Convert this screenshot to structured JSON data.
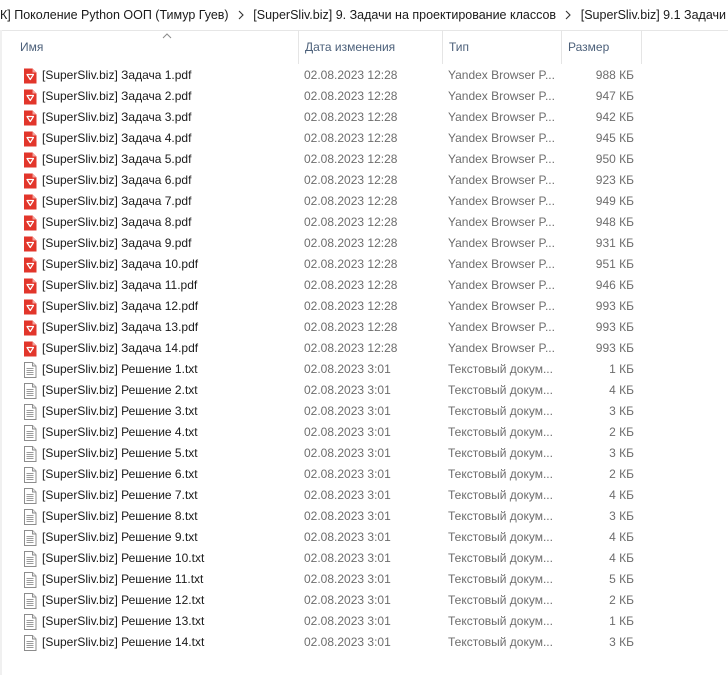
{
  "breadcrumb": {
    "items": [
      "К] Поколение Python ООП (Тимур Гуев)",
      "[SuperSliv.biz] 9. Задачи на проектирование классов",
      "[SuperSliv.biz] 9.1 Задачи"
    ]
  },
  "columns": {
    "name": "Имя",
    "date": "Дата изменения",
    "type": "Тип",
    "size": "Размер"
  },
  "colors": {
    "pdf_icon": "#e2362b",
    "header_text": "#4c607a",
    "secondary_text": "#6d6d6d"
  },
  "files": [
    {
      "name": "[SuperSliv.biz] Задача 1.pdf",
      "date": "02.08.2023 12:28",
      "type": "Yandex Browser P...",
      "size": "988 КБ",
      "icon": "pdf-icon"
    },
    {
      "name": "[SuperSliv.biz] Задача 2.pdf",
      "date": "02.08.2023 12:28",
      "type": "Yandex Browser P...",
      "size": "947 КБ",
      "icon": "pdf-icon"
    },
    {
      "name": "[SuperSliv.biz] Задача 3.pdf",
      "date": "02.08.2023 12:28",
      "type": "Yandex Browser P...",
      "size": "942 КБ",
      "icon": "pdf-icon"
    },
    {
      "name": "[SuperSliv.biz] Задача 4.pdf",
      "date": "02.08.2023 12:28",
      "type": "Yandex Browser P...",
      "size": "945 КБ",
      "icon": "pdf-icon"
    },
    {
      "name": "[SuperSliv.biz] Задача 5.pdf",
      "date": "02.08.2023 12:28",
      "type": "Yandex Browser P...",
      "size": "950 КБ",
      "icon": "pdf-icon"
    },
    {
      "name": "[SuperSliv.biz] Задача 6.pdf",
      "date": "02.08.2023 12:28",
      "type": "Yandex Browser P...",
      "size": "923 КБ",
      "icon": "pdf-icon"
    },
    {
      "name": "[SuperSliv.biz] Задача 7.pdf",
      "date": "02.08.2023 12:28",
      "type": "Yandex Browser P...",
      "size": "949 КБ",
      "icon": "pdf-icon"
    },
    {
      "name": "[SuperSliv.biz] Задача 8.pdf",
      "date": "02.08.2023 12:28",
      "type": "Yandex Browser P...",
      "size": "948 КБ",
      "icon": "pdf-icon"
    },
    {
      "name": "[SuperSliv.biz] Задача 9.pdf",
      "date": "02.08.2023 12:28",
      "type": "Yandex Browser P...",
      "size": "931 КБ",
      "icon": "pdf-icon"
    },
    {
      "name": "[SuperSliv.biz] Задача 10.pdf",
      "date": "02.08.2023 12:28",
      "type": "Yandex Browser P...",
      "size": "951 КБ",
      "icon": "pdf-icon"
    },
    {
      "name": "[SuperSliv.biz] Задача 11.pdf",
      "date": "02.08.2023 12:28",
      "type": "Yandex Browser P...",
      "size": "946 КБ",
      "icon": "pdf-icon"
    },
    {
      "name": "[SuperSliv.biz] Задача 12.pdf",
      "date": "02.08.2023 12:28",
      "type": "Yandex Browser P...",
      "size": "993 КБ",
      "icon": "pdf-icon"
    },
    {
      "name": "[SuperSliv.biz] Задача 13.pdf",
      "date": "02.08.2023 12:28",
      "type": "Yandex Browser P...",
      "size": "993 КБ",
      "icon": "pdf-icon"
    },
    {
      "name": "[SuperSliv.biz] Задача 14.pdf",
      "date": "02.08.2023 12:28",
      "type": "Yandex Browser P...",
      "size": "993 КБ",
      "icon": "pdf-icon"
    },
    {
      "name": "[SuperSliv.biz] Решение 1.txt",
      "date": "02.08.2023 3:01",
      "type": "Текстовый докум...",
      "size": "1 КБ",
      "icon": "txt-icon"
    },
    {
      "name": "[SuperSliv.biz] Решение 2.txt",
      "date": "02.08.2023 3:01",
      "type": "Текстовый докум...",
      "size": "4 КБ",
      "icon": "txt-icon"
    },
    {
      "name": "[SuperSliv.biz] Решение 3.txt",
      "date": "02.08.2023 3:01",
      "type": "Текстовый докум...",
      "size": "3 КБ",
      "icon": "txt-icon"
    },
    {
      "name": "[SuperSliv.biz] Решение 4.txt",
      "date": "02.08.2023 3:01",
      "type": "Текстовый докум...",
      "size": "2 КБ",
      "icon": "txt-icon"
    },
    {
      "name": "[SuperSliv.biz] Решение 5.txt",
      "date": "02.08.2023 3:01",
      "type": "Текстовый докум...",
      "size": "3 КБ",
      "icon": "txt-icon"
    },
    {
      "name": "[SuperSliv.biz] Решение 6.txt",
      "date": "02.08.2023 3:01",
      "type": "Текстовый докум...",
      "size": "2 КБ",
      "icon": "txt-icon"
    },
    {
      "name": "[SuperSliv.biz] Решение 7.txt",
      "date": "02.08.2023 3:01",
      "type": "Текстовый докум...",
      "size": "4 КБ",
      "icon": "txt-icon"
    },
    {
      "name": "[SuperSliv.biz] Решение 8.txt",
      "date": "02.08.2023 3:01",
      "type": "Текстовый докум...",
      "size": "3 КБ",
      "icon": "txt-icon"
    },
    {
      "name": "[SuperSliv.biz] Решение 9.txt",
      "date": "02.08.2023 3:01",
      "type": "Текстовый докум...",
      "size": "4 КБ",
      "icon": "txt-icon"
    },
    {
      "name": "[SuperSliv.biz] Решение 10.txt",
      "date": "02.08.2023 3:01",
      "type": "Текстовый докум...",
      "size": "4 КБ",
      "icon": "txt-icon"
    },
    {
      "name": "[SuperSliv.biz] Решение 11.txt",
      "date": "02.08.2023 3:01",
      "type": "Текстовый докум...",
      "size": "5 КБ",
      "icon": "txt-icon"
    },
    {
      "name": "[SuperSliv.biz] Решение 12.txt",
      "date": "02.08.2023 3:01",
      "type": "Текстовый докум...",
      "size": "2 КБ",
      "icon": "txt-icon"
    },
    {
      "name": "[SuperSliv.biz] Решение 13.txt",
      "date": "02.08.2023 3:01",
      "type": "Текстовый докум...",
      "size": "1 КБ",
      "icon": "txt-icon"
    },
    {
      "name": "[SuperSliv.biz] Решение 14.txt",
      "date": "02.08.2023 3:01",
      "type": "Текстовый докум...",
      "size": "3 КБ",
      "icon": "txt-icon"
    }
  ]
}
